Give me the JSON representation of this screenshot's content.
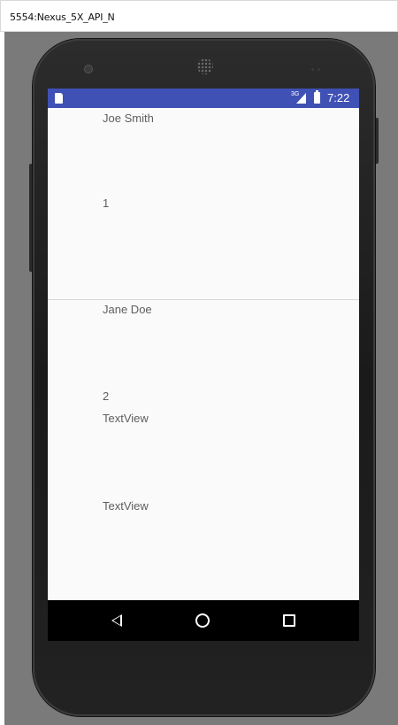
{
  "window": {
    "title": "5554:Nexus_5X_API_N"
  },
  "status_bar": {
    "network": "3G",
    "time": "7:22",
    "color": "#3f51b5"
  },
  "list_items": [
    {
      "name": "Joe Smith",
      "number": "1"
    },
    {
      "name": "Jane Doe",
      "number": "2"
    }
  ],
  "text_views": [
    "TextView",
    "TextView"
  ],
  "nav_bar": {
    "icons": [
      "back-icon",
      "home-icon",
      "recents-icon"
    ]
  }
}
